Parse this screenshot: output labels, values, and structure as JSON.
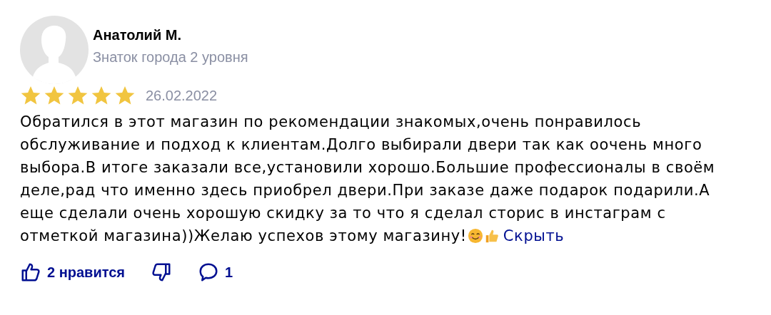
{
  "author": {
    "name": "Анатолий М.",
    "subtitle": "Знаток города 2 уровня"
  },
  "review": {
    "stars": 5,
    "date": "26.02.2022",
    "text": "Обратился в этот магазин по рекомендации знакомых,очень понравилось обслуживание и подход к клиентам.Долго выбирали двери так как оочень много выбора.В итоге заказали все,установили хорошо.Большие профессионалы в своём деле,рад что именно здесь приобрел двери.При заказе даже подарок подарили.А еще сделали очень хорошую скидку за то что я сделал сторис в инстаграм с отметкой магазина))Желаю успехов этому магазину!",
    "collapse_link": "Скрыть"
  },
  "actions": {
    "likes": "2 нравится",
    "comments": "1"
  }
}
